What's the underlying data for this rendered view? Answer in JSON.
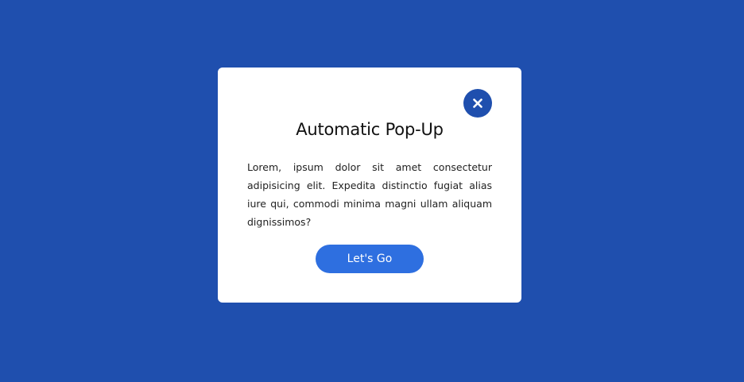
{
  "popup": {
    "title": "Automatic Pop-Up",
    "body": "Lorem, ipsum dolor sit amet consectetur adipisicing elit. Expedita distinctio fugiat alias iure qui, commodi minima magni ullam aliquam dignissimos?",
    "button_label": "Let's Go",
    "close_icon": "close-icon"
  },
  "colors": {
    "background": "#1f4fae",
    "card": "#ffffff",
    "close_button": "#1f4fae",
    "primary_button": "#2e6fe0"
  }
}
